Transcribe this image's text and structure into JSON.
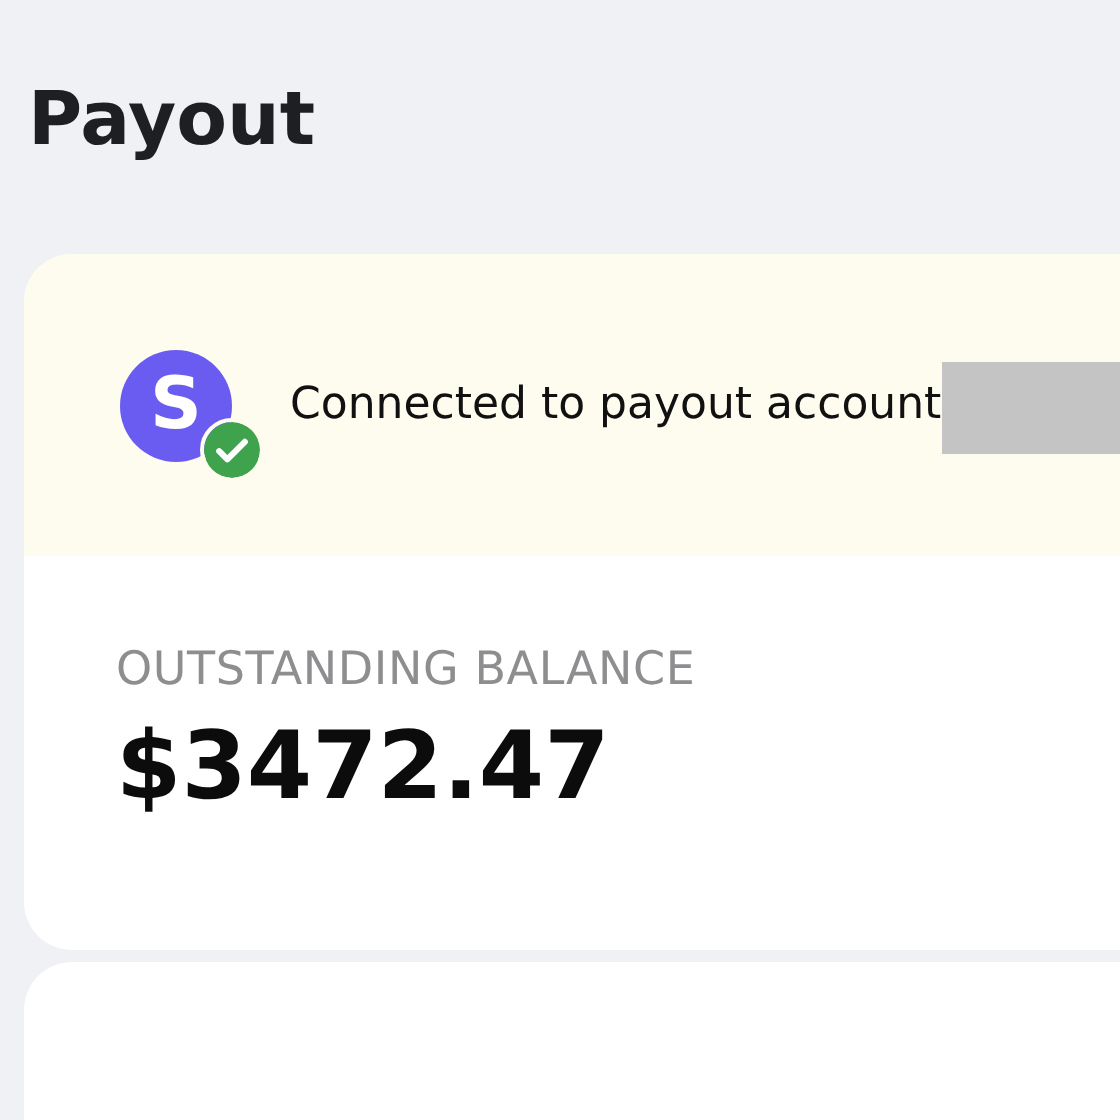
{
  "page": {
    "title": "Payout"
  },
  "payout_card": {
    "account": {
      "logo_letter": "S",
      "connected": true,
      "status": "Connected to payout account"
    },
    "balance": {
      "label": "OUTSTANDING BALANCE",
      "amount": "$3472.47"
    }
  }
}
